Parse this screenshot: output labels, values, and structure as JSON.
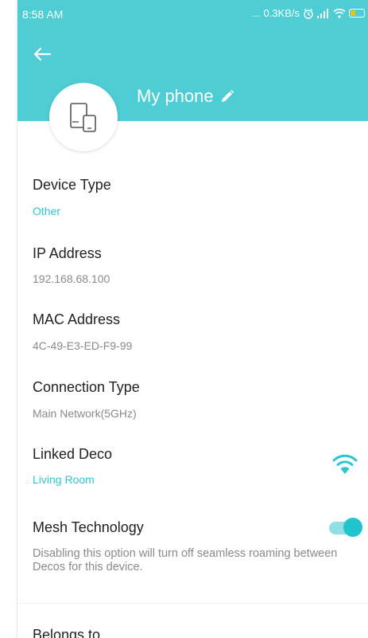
{
  "status_bar": {
    "time": "8:58 AM",
    "speed": "... 0.3KB/s"
  },
  "header": {
    "title": "My phone",
    "background": "#4ecdd4"
  },
  "icons": {
    "back": "back-arrow-icon",
    "edit": "pencil-icon",
    "device": "phone-tablet-icon",
    "signal": "wifi-signal-icon"
  },
  "fields": {
    "device_type": {
      "label": "Device Type",
      "value": "Other"
    },
    "ip_address": {
      "label": "IP Address",
      "value": "192.168.68.100"
    },
    "mac_address": {
      "label": "MAC Address",
      "value": "4C-49-E3-ED-F9-99"
    },
    "connection_type": {
      "label": "Connection Type",
      "value": "Main Network(5GHz)"
    },
    "linked_deco": {
      "label": "Linked Deco",
      "value": "Living Room"
    }
  },
  "mesh": {
    "label": "Mesh Technology",
    "enabled": true,
    "description": "Disabling this option will turn off seamless roaming between Decos for this device."
  },
  "belongs_to": {
    "label": "Belongs to"
  },
  "colors": {
    "accent": "#2ec7cf",
    "secondary_text": "#8a8a8a",
    "primary_text": "#222222"
  }
}
